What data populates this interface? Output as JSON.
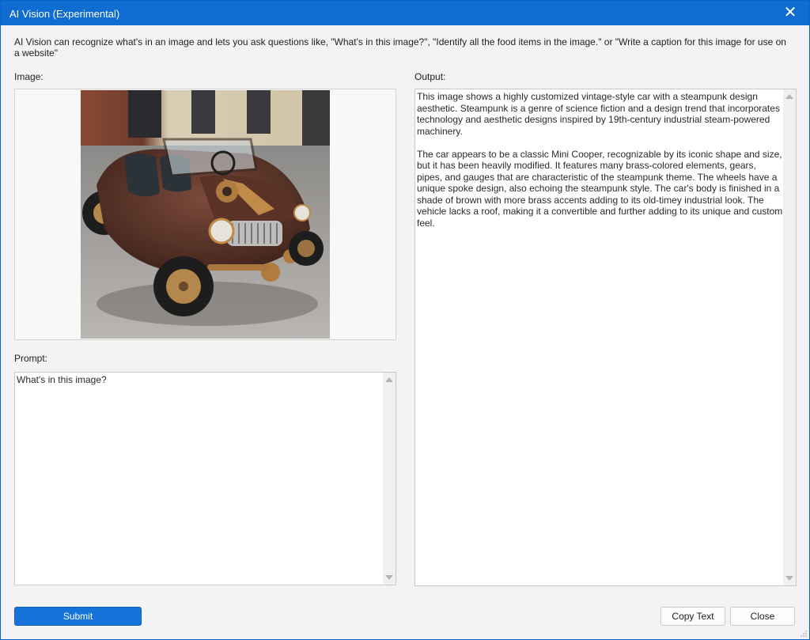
{
  "window": {
    "title": "AI Vision (Experimental)",
    "close_glyph": "✕"
  },
  "description": "AI Vision can recognize what's in an image and lets you ask questions like, \"What's in this image?\", \"Identify all the food items in the image.\" or \"Write a caption for this image for use on a website\"",
  "image_section": {
    "label": "Image:",
    "image_subject": "steampunk-style brown vintage Mini Cooper convertible with brass gears and spoke wheels"
  },
  "prompt_section": {
    "label": "Prompt:",
    "value": "What's in this image?"
  },
  "output_section": {
    "label": "Output:",
    "value": "This image shows a highly customized vintage-style car with a steampunk design aesthetic. Steampunk is a genre of science fiction and a design trend that incorporates technology and aesthetic designs inspired by 19th-century industrial steam-powered machinery.\n\nThe car appears to be a classic Mini Cooper, recognizable by its iconic shape and size, but it has been heavily modified. It features many brass-colored elements, gears, pipes, and gauges that are characteristic of the steampunk theme. The wheels have a unique spoke design, also echoing the steampunk style. The car's body is finished in a shade of brown with more brass accents adding to its old-timey industrial look. The vehicle lacks a roof, making it a convertible and further adding to its unique and custom feel."
  },
  "buttons": {
    "submit": "Submit",
    "copy_text": "Copy Text",
    "close": "Close"
  },
  "colors": {
    "accent": "#0f6cd0",
    "background": "#f3f3f3",
    "car_body": "#4a2a22",
    "brass": "#c08a48"
  }
}
